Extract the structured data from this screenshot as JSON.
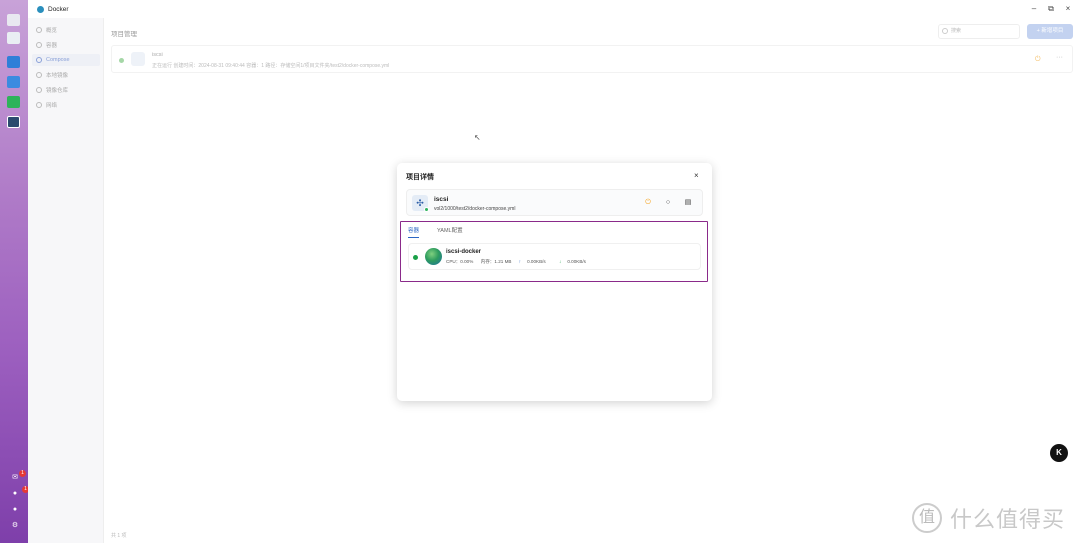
{
  "window": {
    "title": "Docker"
  },
  "sidebar": {
    "items": [
      {
        "label": "概览"
      },
      {
        "label": "容器"
      },
      {
        "label": "Compose"
      },
      {
        "label": "本地镜像"
      },
      {
        "label": "镜像仓库"
      },
      {
        "label": "网络"
      }
    ]
  },
  "page": {
    "title": "项目管理",
    "search_placeholder": "搜索",
    "add_button": "+ 新增项目",
    "footer": "共 1 项"
  },
  "project_row": {
    "name": "iscsi",
    "meta": "正在运行   创建时间：2024-08-31 09:40:44   容器：1   路径：存储空间1/项目文件夹/test2/docker-compose.yml"
  },
  "modal": {
    "title": "项目详情",
    "project": {
      "name": "iscsi",
      "path": "vol2/1000/test2/docker-compose.yml"
    },
    "tabs": [
      {
        "label": "容器"
      },
      {
        "label": "YAML配置"
      }
    ],
    "container": {
      "name": "iscsi-docker",
      "cpu": "CPU：0.00%",
      "mem": "内存：1.21 MB",
      "up": "0.00KB/s",
      "down": "0.00KB/s"
    }
  },
  "watermark": {
    "badge": "K",
    "site": "什么值得买",
    "glyph": "值"
  },
  "colors": {
    "accent": "#2b66c4",
    "running": "#1aa048",
    "highlight": "#8a2a8a",
    "power": "#f5a524"
  }
}
